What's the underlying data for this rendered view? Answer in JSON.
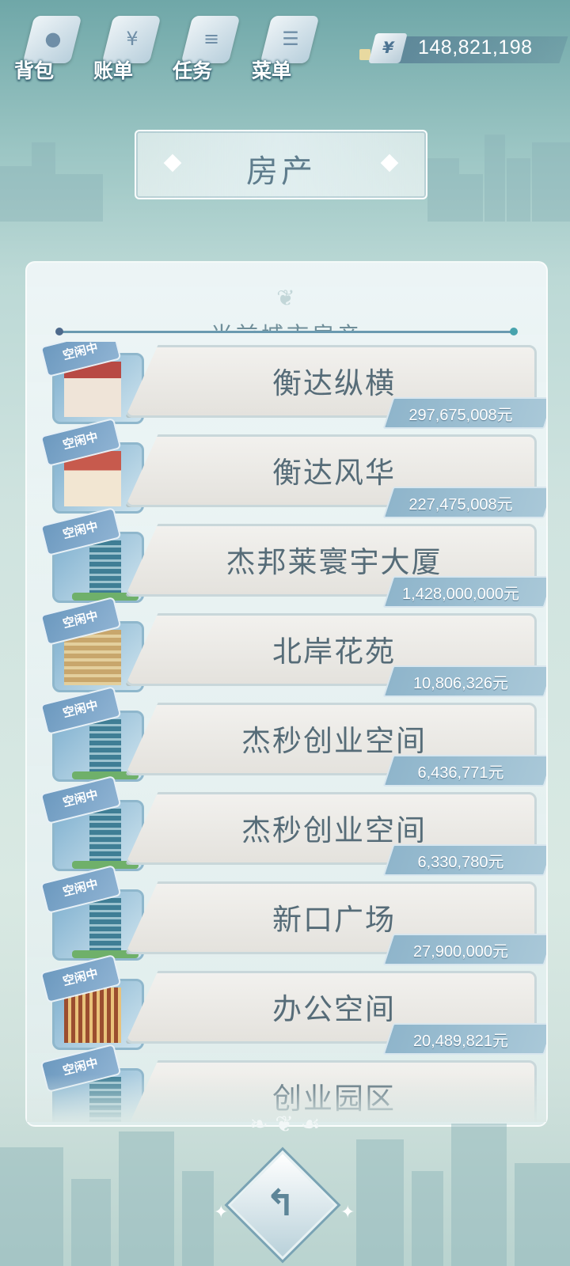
{
  "top_menu": [
    {
      "label": "背包",
      "icon": "backpack-icon"
    },
    {
      "label": "账单",
      "icon": "bill-icon"
    },
    {
      "label": "任务",
      "icon": "task-icon"
    },
    {
      "label": "菜单",
      "icon": "menu-icon"
    }
  ],
  "money": {
    "currency_symbol": "¥",
    "value": "148,821,198"
  },
  "page_title": "房产",
  "list_title": "当前城市房产",
  "properties": [
    {
      "status": "空闲中",
      "name": "衡达纵横",
      "price": "297,675,008元",
      "thumb": "villa"
    },
    {
      "status": "空闲中",
      "name": "衡达风华",
      "price": "227,475,008元",
      "thumb": "villa2"
    },
    {
      "status": "空闲中",
      "name": "杰邦莱寰宇大厦",
      "price": "1,428,000,000元",
      "thumb": "tower"
    },
    {
      "status": "空闲中",
      "name": "北岸花苑",
      "price": "10,806,326元",
      "thumb": "block"
    },
    {
      "status": "空闲中",
      "name": "杰秒创业空间",
      "price": "6,436,771元",
      "thumb": "tower"
    },
    {
      "status": "空闲中",
      "name": "杰秒创业空间",
      "price": "6,330,780元",
      "thumb": "tower"
    },
    {
      "status": "空闲中",
      "name": "新口广场",
      "price": "27,900,000元",
      "thumb": "tower"
    },
    {
      "status": "空闲中",
      "name": "办公空间",
      "price": "20,489,821元",
      "thumb": "office"
    },
    {
      "status": "空闲中",
      "name": "创业园区",
      "price": "",
      "thumb": "tower"
    }
  ],
  "back_icon": "back-arrow-icon",
  "colors": {
    "accent": "#8fb5cb",
    "text": "#566c78",
    "background": "#cfe3df"
  }
}
